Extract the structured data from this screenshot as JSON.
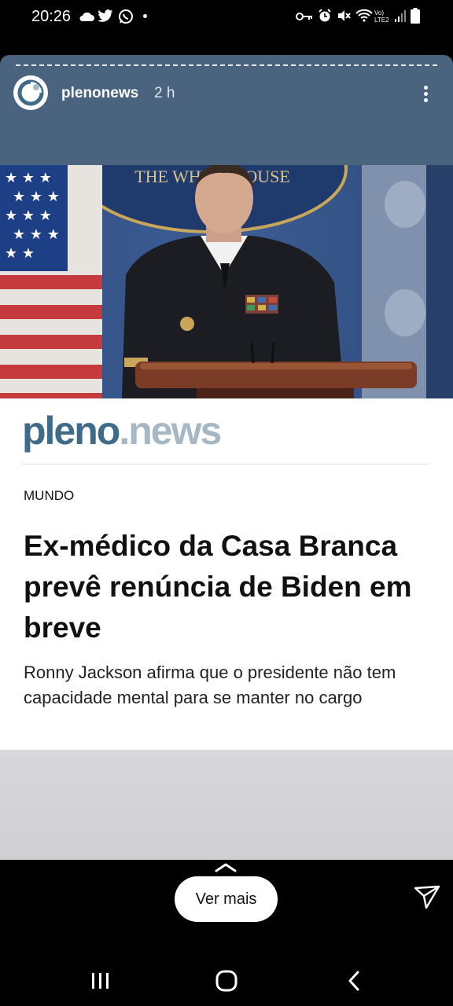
{
  "status_bar": {
    "time": "20:26"
  },
  "story": {
    "username": "plenonews",
    "time_ago": "2 h"
  },
  "article": {
    "logo_part1": "pleno",
    "logo_part2": ".news",
    "category": "MUNDO",
    "headline": "Ex-médico da Casa Branca prevê renúncia de Biden em breve",
    "subtitle": "Ronny Jackson afirma que o presidente não tem capacidade mental para se manter no cargo",
    "photo_sign_text": "THE WHITE HOUSE"
  },
  "actions": {
    "see_more_label": "Ver mais"
  },
  "colors": {
    "story_header_bg": "#4a6480",
    "logo_primary": "#3f6b8b",
    "logo_secondary": "#a6b7c6"
  }
}
